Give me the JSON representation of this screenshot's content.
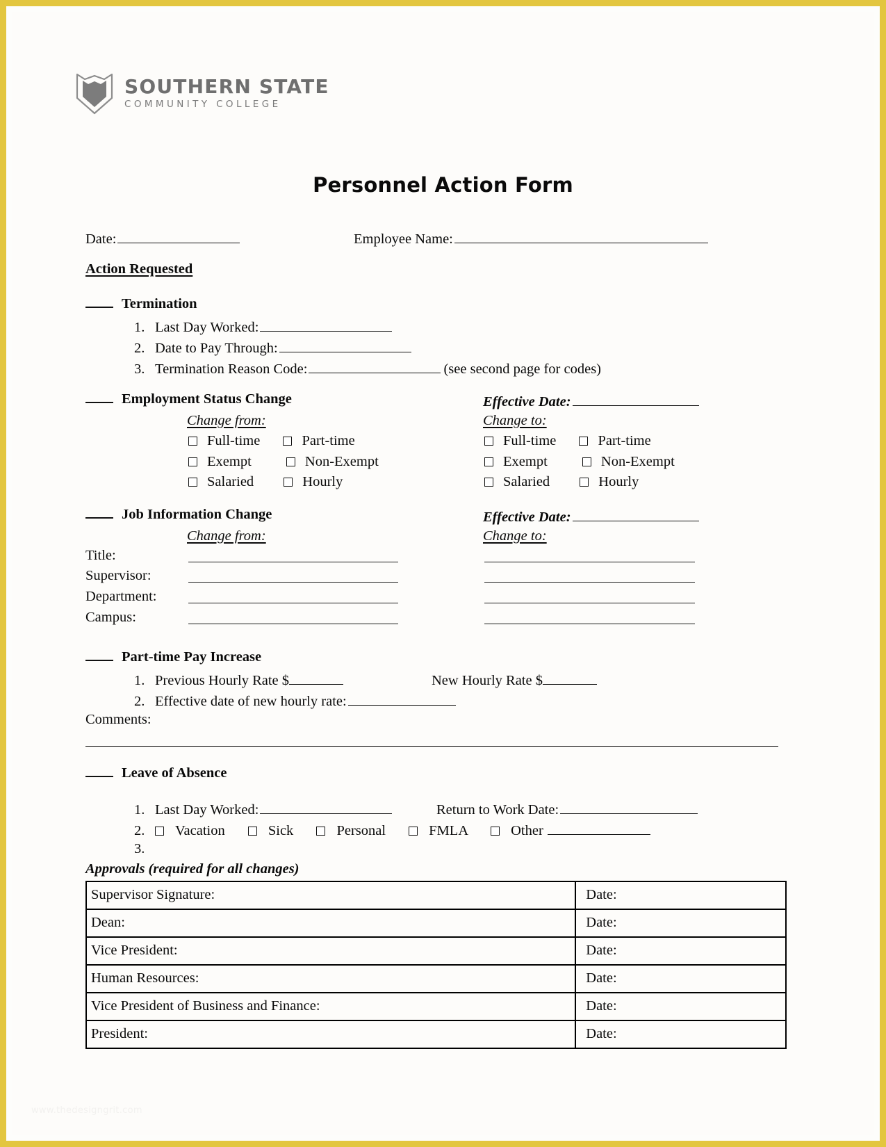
{
  "brand": {
    "line1": "SOUTHERN STATE",
    "line2": "COMMUNITY COLLEGE",
    "logo_icon": "shield-book-icon",
    "logo_color": "#7a7a7a",
    "frame_color": "#e3c63f"
  },
  "title": "Personnel Action Form",
  "header_fields": {
    "date_label": "Date:",
    "employee_name_label": "Employee Name:"
  },
  "action_requested_heading": "Action Requested",
  "termination": {
    "heading": "Termination",
    "items": [
      {
        "num": "1.",
        "label": "Last Day Worked:"
      },
      {
        "num": "2.",
        "label": "Date to Pay Through:"
      },
      {
        "num": "3.",
        "label": "Termination Reason Code:",
        "note": "(see second page for codes)"
      }
    ]
  },
  "employment_status_change": {
    "heading": "Employment Status Change",
    "effective_date_label": "Effective Date:",
    "change_from_label": "Change from:",
    "change_to_label": "Change to:",
    "options": [
      [
        "Full-time",
        "Part-time"
      ],
      [
        "Exempt",
        "Non-Exempt"
      ],
      [
        "Salaried",
        "Hourly"
      ]
    ]
  },
  "job_information_change": {
    "heading": "Job Information Change",
    "effective_date_label": "Effective Date:",
    "change_from_label": "Change from:",
    "change_to_label": "Change to:",
    "fields": [
      "Title:",
      "Supervisor:",
      "Department:",
      "Campus:"
    ]
  },
  "part_time_pay_increase": {
    "heading": "Part-time Pay Increase",
    "items": [
      {
        "num": "1.",
        "label_a": "Previous Hourly Rate $",
        "label_b": "New Hourly Rate $"
      },
      {
        "num": "2.",
        "label_a": "Effective date of new hourly rate:"
      }
    ],
    "comments_label": "Comments:"
  },
  "leave_of_absence": {
    "heading": "Leave of Absence",
    "item1_num": "1.",
    "last_day_worked_label": "Last Day Worked:",
    "return_to_work_label": "Return to Work Date:",
    "item2_num": "2.",
    "checkboxes": [
      "Vacation",
      "Sick",
      "Personal",
      "FMLA",
      "Other"
    ],
    "item3_num": "3."
  },
  "approvals": {
    "heading": "Approvals (required for all changes)",
    "date_label": "Date:",
    "rows": [
      "Supervisor Signature:",
      "Dean:",
      "Vice President:",
      "Human Resources:",
      "Vice President of Business and Finance:",
      "President:"
    ]
  },
  "watermark": "www.thedesigngrit.com"
}
